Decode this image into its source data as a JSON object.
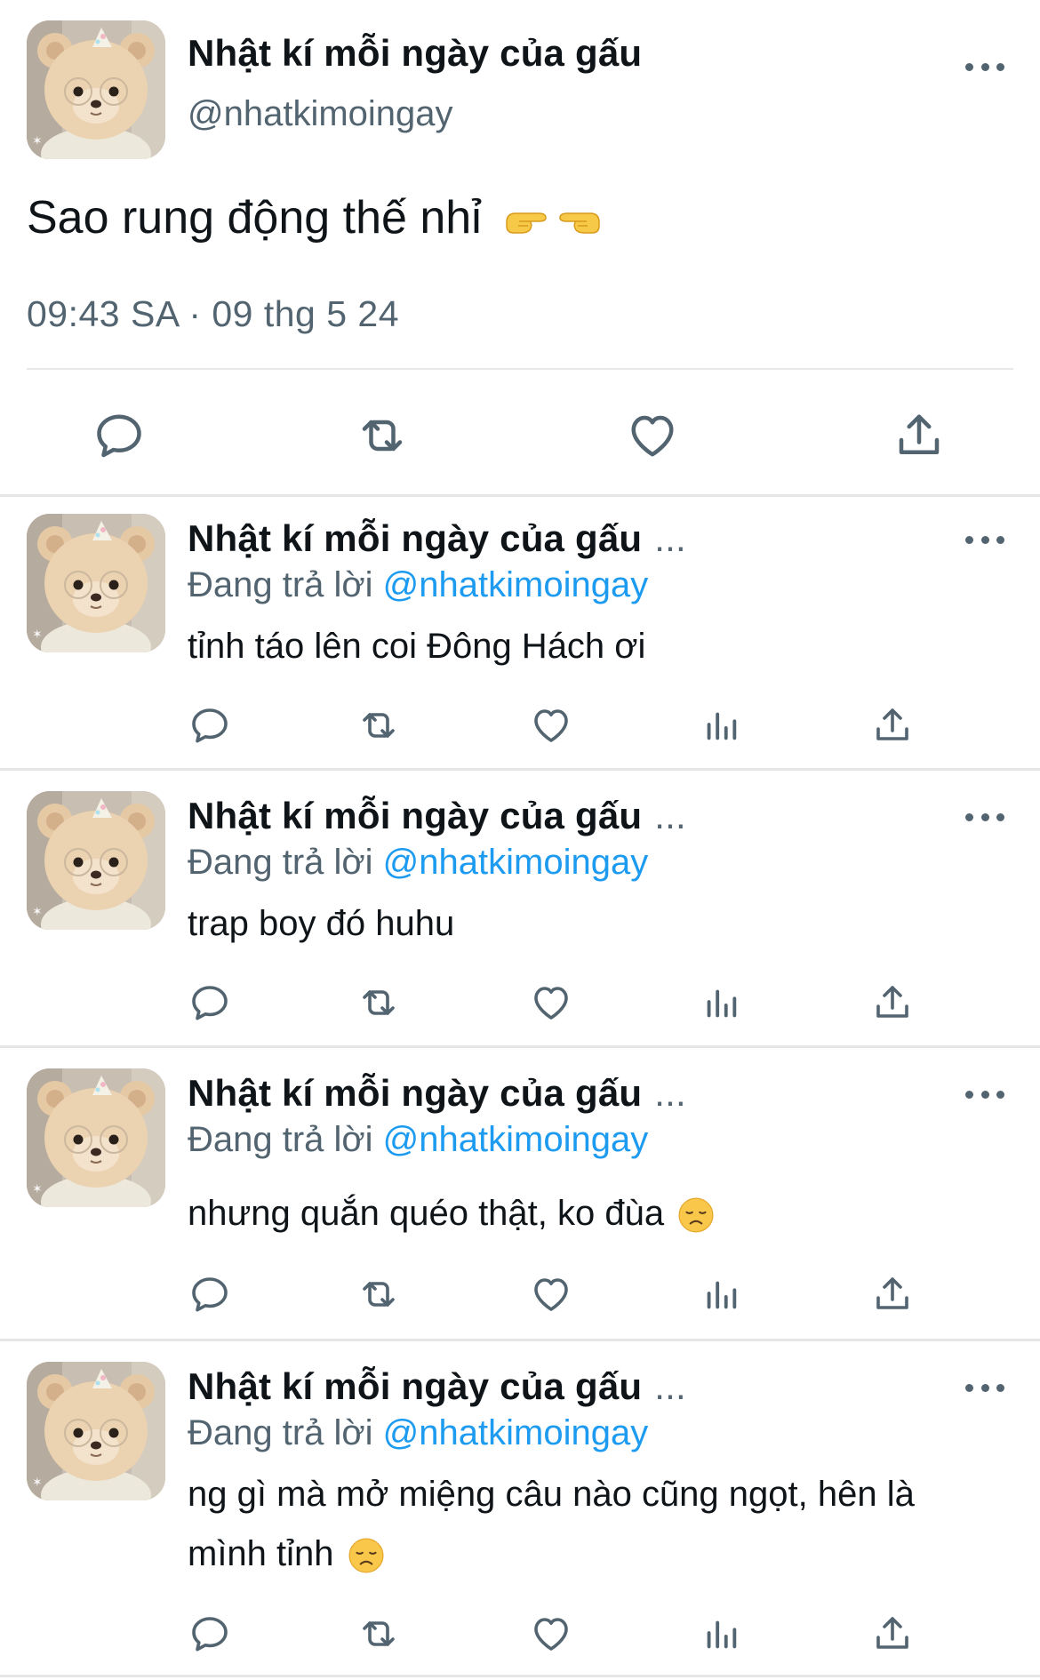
{
  "main_tweet": {
    "author_name": "Nhật kí mỗi ngày của gấu",
    "handle": "@nhatkimoingay",
    "text": "Sao rung động thế nhỉ",
    "emojis": [
      "backhand-index-pointing-right",
      "backhand-index-pointing-left"
    ],
    "timestamp": "09:43 SA · 09 thg 5 24",
    "actions": [
      "reply",
      "retweet",
      "like",
      "share"
    ]
  },
  "replies": [
    {
      "author_name": "Nhật kí mỗi ngày của gấu",
      "ellipsis": "...",
      "replying_label": "Đang trả lời",
      "mention": "@nhatkimoingay",
      "text": "tỉnh táo lên coi Đông Hách ơi"
    },
    {
      "author_name": "Nhật kí mỗi ngày của gấu",
      "ellipsis": "...",
      "replying_label": "Đang trả lời",
      "mention": "@nhatkimoingay",
      "text": "trap boy đó huhu"
    },
    {
      "author_name": "Nhật kí mỗi ngày của gấu",
      "ellipsis": "...",
      "replying_label": "Đang trả lời",
      "mention": "@nhatkimoingay",
      "text": "nhưng quắn quéo thật, ko đùa",
      "emoji": "disappointed-face"
    },
    {
      "author_name": "Nhật kí mỗi ngày của gấu",
      "ellipsis": "...",
      "replying_label": "Đang trả lời",
      "mention": "@nhatkimoingay",
      "text_line1": "ng gì mà mở miệng câu nào cũng ngọt, hên là",
      "text_line2": "mình tỉnh",
      "emoji": "disappointed-face"
    }
  ],
  "reply_actions": [
    "reply",
    "retweet",
    "like",
    "views",
    "share"
  ],
  "colors": {
    "text": "#0f1419",
    "secondary": "#536471",
    "mention": "#1d9bf0",
    "divider": "#e4e6e8"
  }
}
